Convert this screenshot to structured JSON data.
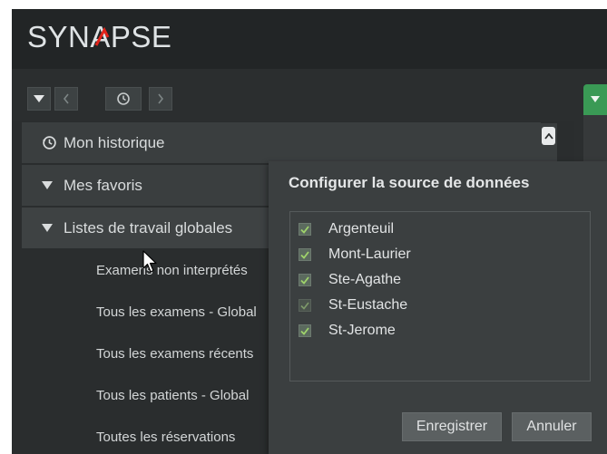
{
  "header": {
    "brand": "SYNAPSE"
  },
  "toolbar": {
    "buttons": [
      {
        "name": "collapse-dropdown",
        "icon": "triangle-down-icon"
      },
      {
        "name": "back",
        "icon": "chevron-left-icon"
      },
      {
        "name": "history",
        "icon": "history-icon"
      },
      {
        "name": "forward",
        "icon": "chevron-right-icon"
      }
    ]
  },
  "sidebar": {
    "sections": [
      {
        "label": "Mon historique",
        "icon": "history-icon"
      },
      {
        "label": "Mes favoris",
        "icon": "triangle-down-icon"
      },
      {
        "label": "Listes de travail globales",
        "icon": "triangle-down-icon"
      }
    ],
    "worklists": [
      "Examens non interprétés",
      "Tous les examens - Global",
      "Tous les examens récents",
      "Tous les patients - Global",
      "Toutes les réservations"
    ]
  },
  "dialog": {
    "title": "Configurer la source de données",
    "sources": [
      {
        "label": "Argenteuil",
        "checked": true
      },
      {
        "label": "Mont-Laurier",
        "checked": true
      },
      {
        "label": "Ste-Agathe",
        "checked": true
      },
      {
        "label": "St-Eustache",
        "checked": true
      },
      {
        "label": "St-Jerome",
        "checked": true
      }
    ],
    "save_label": "Enregistrer",
    "cancel_label": "Annuler"
  },
  "colors": {
    "accent_red": "#e2231a",
    "accent_green": "#3a9a55",
    "check_green": "#9fd36b"
  }
}
